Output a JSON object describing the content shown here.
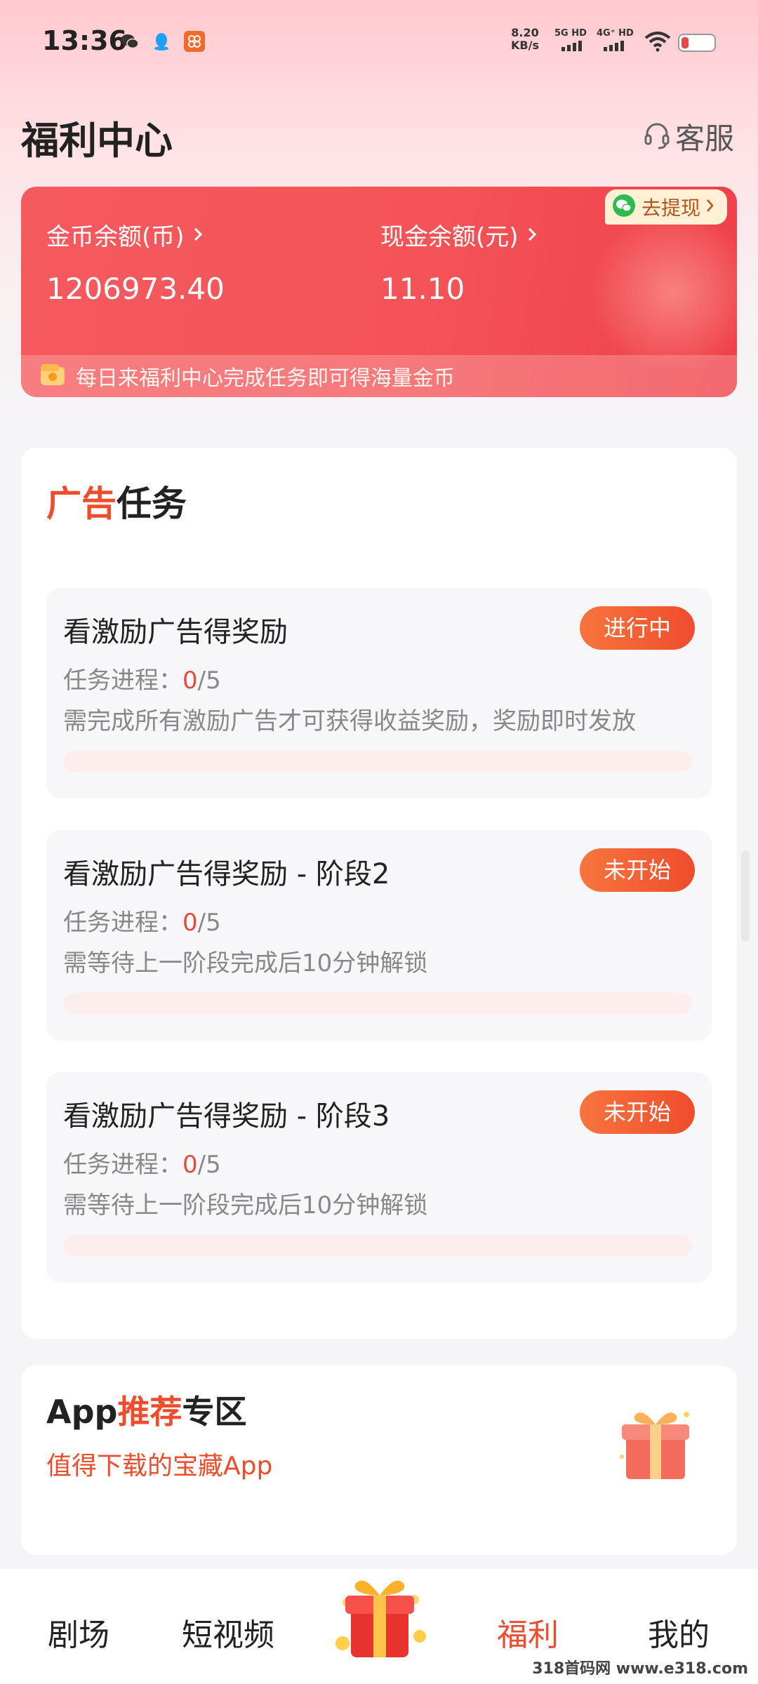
{
  "status_bar": {
    "time": "13:36",
    "net_speed_value": "8.20",
    "net_speed_unit": "KB/s",
    "signal1": "5G HD",
    "signal2": "4G⁺ HD"
  },
  "header": {
    "title": "福利中心",
    "service_label": "客服"
  },
  "balance": {
    "coin_label": "金币余额(币)",
    "coin_value": "1206973.40",
    "cash_label": "现金余额(元)",
    "cash_value": "11.10",
    "withdraw_label": "去提现",
    "footer_text": "每日来福利中心完成任务即可得海量金币"
  },
  "ad_tasks": {
    "title_highlight": "广告",
    "title_rest": "任务",
    "progress_label": "任务进程：",
    "items": [
      {
        "title": "看激励广告得奖励",
        "status": "进行中",
        "done": "0",
        "total": "/5",
        "desc": "需完成所有激励广告才可获得收益奖励，奖励即时发放",
        "progress_fraction": 0
      },
      {
        "title": "看激励广告得奖励 - 阶段2",
        "status": "未开始",
        "done": "0",
        "total": "/5",
        "desc": "需等待上一阶段完成后10分钟解锁",
        "progress_fraction": 0
      },
      {
        "title": "看激励广告得奖励 - 阶段3",
        "status": "未开始",
        "done": "0",
        "total": "/5",
        "desc": "需等待上一阶段完成后10分钟解锁",
        "progress_fraction": 0
      }
    ]
  },
  "app_zone": {
    "title_a": "App",
    "title_highlight": "推荐",
    "title_b": "专区",
    "subtitle": "值得下载的宝藏App"
  },
  "bottom_nav": {
    "items": [
      "剧场",
      "短视频",
      "福利",
      "我的"
    ],
    "active": "福利"
  },
  "watermark": "318首码网 www.e318.com",
  "colors": {
    "accent": "#ee4d2d",
    "card_red": "#f45458",
    "badge_orange": "#f7753d"
  },
  "icons": [
    "wechat-icon",
    "qq-icon",
    "app-notification-icon",
    "wifi-icon",
    "battery-icon",
    "headset-icon",
    "chevron-right-icon",
    "coin-wallet-icon",
    "gift-icon"
  ]
}
